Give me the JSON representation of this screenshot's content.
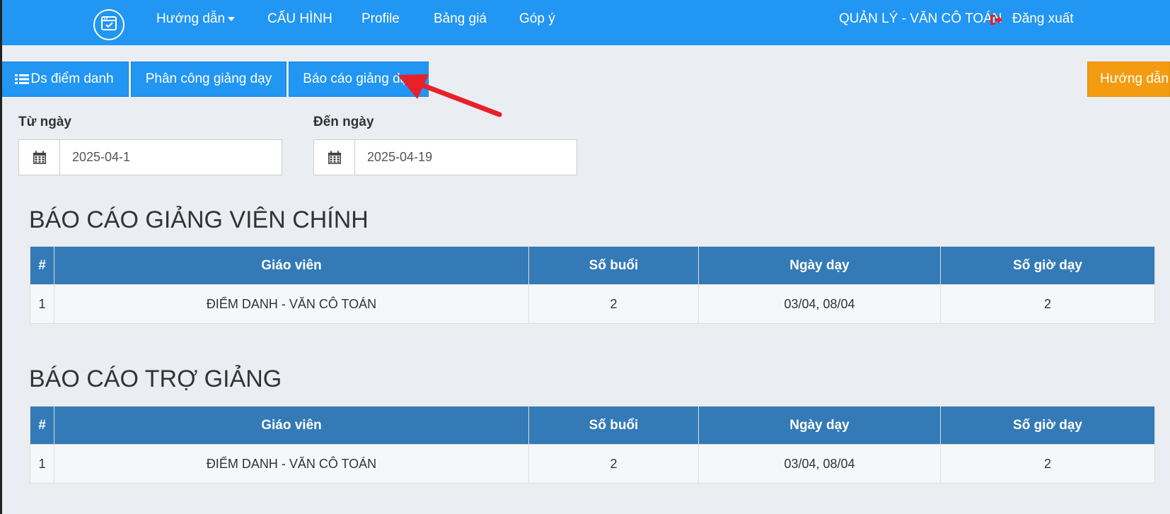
{
  "navbar": {
    "logo_icon": "calendar-check-icon",
    "items": [
      {
        "label": "Hướng dẫn",
        "dropdown": true
      },
      {
        "label": "CẤU HÌNH"
      },
      {
        "label": "Profile"
      },
      {
        "label": "Bảng giá"
      },
      {
        "label": "Góp ý"
      }
    ],
    "user": "QUẢN LÝ - VĂN CÔ TOÁN",
    "logout_label": "Đăng xuất"
  },
  "tabs": [
    {
      "label": "Ds điểm danh",
      "icon": "list-icon"
    },
    {
      "label": "Phân công giảng dạy"
    },
    {
      "label": "Báo cáo giảng dạy"
    }
  ],
  "guide_button": "Hướng dẫn",
  "filters": {
    "from_label": "Từ ngày",
    "from_value": "2025-04-1",
    "to_label": "Đến ngày",
    "to_value": "2025-04-19"
  },
  "main_report": {
    "title": "BÁO CÁO GIẢNG VIÊN CHÍNH",
    "headers": [
      "#",
      "Giáo viên",
      "Số buổi",
      "Ngày dạy",
      "Số giờ dạy"
    ],
    "rows": [
      [
        "1",
        "ĐIỂM DANH - VĂN CÔ TOÁN",
        "2",
        "03/04, 08/04",
        "2"
      ]
    ]
  },
  "assistant_report": {
    "title": "BÁO CÁO TRỢ GIẢNG",
    "headers": [
      "#",
      "Giáo viên",
      "Số buổi",
      "Ngày dạy",
      "Số giờ dạy"
    ],
    "rows": [
      [
        "1",
        "ĐIỂM DANH - VĂN CÔ TOÁN",
        "2",
        "03/04, 08/04",
        "2"
      ]
    ]
  },
  "colors": {
    "primary": "#2196f3",
    "table_header": "#337ab7",
    "warning": "#f39c12",
    "annotation_arrow": "#e8202a"
  }
}
